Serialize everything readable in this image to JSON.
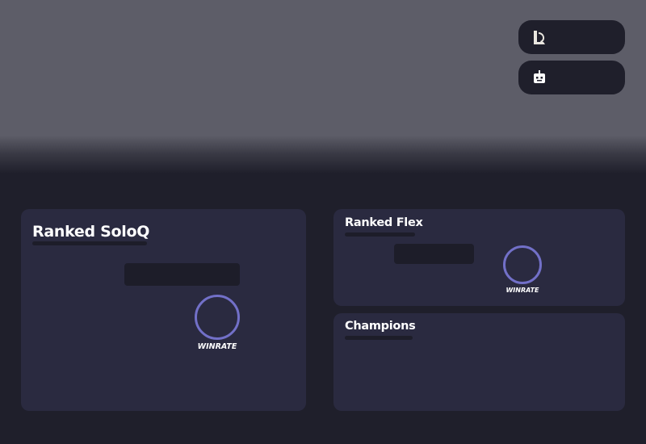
{
  "header": {
    "buttons": [
      {
        "icon": "league-of-legends-logo-icon"
      },
      {
        "icon": "robot-icon"
      }
    ]
  },
  "cards": {
    "solo": {
      "title": "Ranked SoloQ",
      "winrate_label": "WINRATE"
    },
    "flex": {
      "title": "Ranked Flex",
      "winrate_label": "WINRATE"
    },
    "champions": {
      "title": "Champions"
    }
  },
  "colors": {
    "hero_bg": "#5d5d68",
    "page_bg": "#1f1f2b",
    "card_bg": "#2a2a40",
    "placeholder": "#1d1d29",
    "winrate_ring": "#7270c8"
  }
}
